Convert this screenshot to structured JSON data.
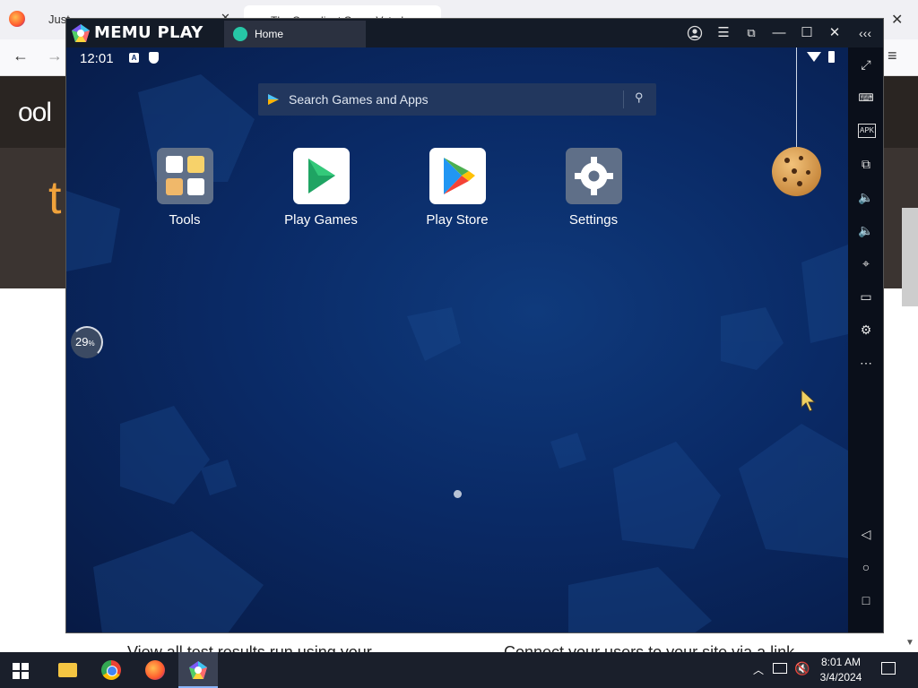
{
  "browser": {
    "tab_partial_left": "Just",
    "tab_active_title": "The Compliant Game Voted ...",
    "hero_letter": "t",
    "logo_partial": "ool",
    "bottom_text_left": "View all test results run using your",
    "bottom_text_right": "Connect your users to your site via a link"
  },
  "memu": {
    "brand": "MEMU PLAY",
    "tab_label": "Home",
    "title_buttons": [
      "account-icon",
      "menu-icon",
      "screen-icon",
      "minimize-icon",
      "maximize-icon",
      "close-icon",
      "collapse-icon"
    ]
  },
  "android": {
    "clock": "12:01",
    "search_placeholder": "Search Games and Apps",
    "apps": [
      {
        "label": "Tools"
      },
      {
        "label": "Play Games"
      },
      {
        "label": "Play Store"
      },
      {
        "label": "Settings"
      }
    ],
    "progress_text": "29",
    "progress_unit": "%",
    "progress_value": 29
  },
  "sidebar": {
    "items": [
      "fullscreen-icon",
      "keyboard-icon",
      "apk-icon",
      "multi-window-icon",
      "volume-up-icon",
      "volume-down-icon",
      "location-icon",
      "folder-icon",
      "settings-icon",
      "more-icon",
      "back-icon",
      "home-icon",
      "recents-icon"
    ],
    "apk_label": "APK"
  },
  "taskbar": {
    "time": "8:01 AM",
    "date": "3/4/2024",
    "apps": [
      "file-explorer-icon",
      "chrome-icon",
      "firefox-icon",
      "memu-icon"
    ]
  },
  "colors": {
    "memu_title_bg": "#141b27",
    "android_bg": "#0b2150",
    "accent_green": "#26c6a6"
  }
}
